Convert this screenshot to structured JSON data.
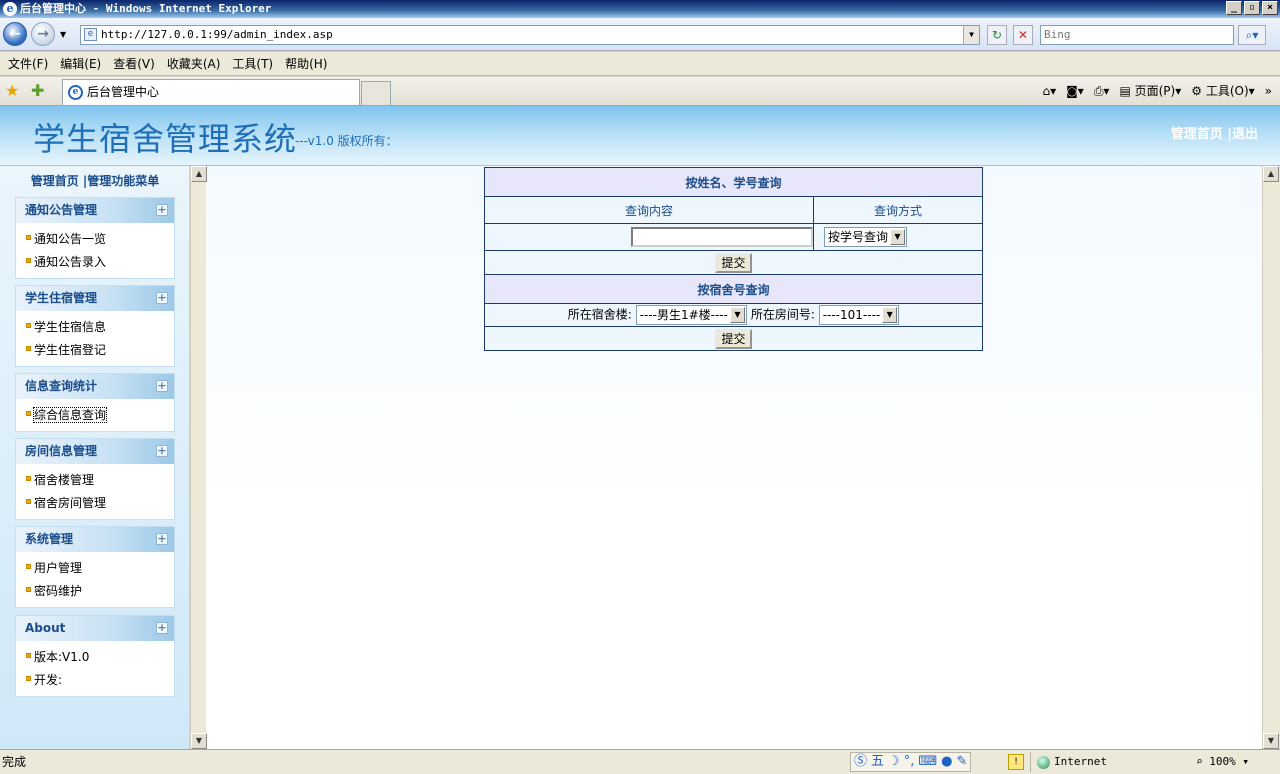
{
  "window": {
    "title": "后台管理中心 - Windows Internet Explorer"
  },
  "address": {
    "url": "http://127.0.0.1:99/admin_index.asp",
    "search_placeholder": "Bing"
  },
  "menubar": [
    "文件(F)",
    "编辑(E)",
    "查看(V)",
    "收藏夹(A)",
    "工具(T)",
    "帮助(H)"
  ],
  "tab": {
    "title": "后台管理中心"
  },
  "commandbar": {
    "page": "页面(P)",
    "tools": "工具(O)"
  },
  "banner": {
    "title": "学生宿舍管理系统",
    "version": "---v1.0 版权所有：",
    "home_link": "管理首页",
    "logout_link": "|退出"
  },
  "left": {
    "header": "管理首页 |管理功能菜单",
    "groups": [
      {
        "title": "通知公告管理",
        "items": [
          "通知公告一览",
          "通知公告录入"
        ]
      },
      {
        "title": "学生住宿管理",
        "items": [
          "学生住宿信息",
          "学生住宿登记"
        ]
      },
      {
        "title": "信息查询统计",
        "items": [
          "综合信息查询"
        ]
      },
      {
        "title": "房间信息管理",
        "items": [
          "宿舍楼管理",
          "宿舍房间管理"
        ]
      },
      {
        "title": "系统管理",
        "items": [
          "用户管理",
          "密码维护"
        ]
      },
      {
        "title": "About",
        "items": [
          "版本:V1.0",
          "开发:"
        ]
      }
    ]
  },
  "query_name": {
    "header": "按姓名、学号查询",
    "col_content": "查询内容",
    "col_method": "查询方式",
    "input_value": "",
    "method_selected": "按学号查询",
    "submit": "提交"
  },
  "query_room": {
    "header": "按宿舍号查询",
    "building_label": "所在宿舍楼:",
    "building_selected": "----男生1#楼----",
    "room_label": "所在房间号:",
    "room_selected": "----101----",
    "submit": "提交"
  },
  "status": {
    "text": "完成",
    "zone": "Internet",
    "zoom": "100%"
  }
}
